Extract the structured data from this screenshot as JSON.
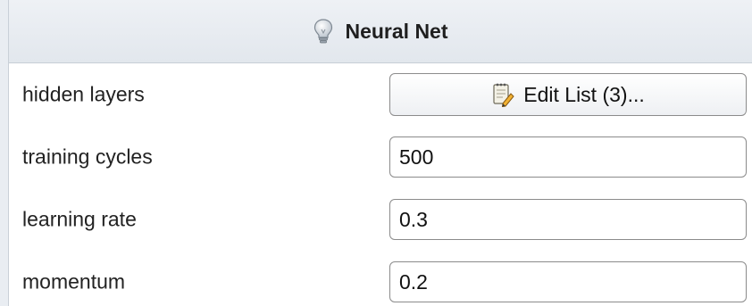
{
  "header": {
    "title": "Neural Net",
    "icon": "lightbulb-icon"
  },
  "parameters": [
    {
      "label": "hidden layers",
      "type": "button",
      "button_label": "Edit List (3)...",
      "icon": "notepad-edit-icon"
    },
    {
      "label": "training cycles",
      "type": "input",
      "value": "500"
    },
    {
      "label": "learning rate",
      "type": "input",
      "value": "0.3"
    },
    {
      "label": "momentum",
      "type": "input",
      "value": "0.2"
    }
  ],
  "colors": {
    "header_bg": "#e6eaef",
    "border": "#8b8b8b",
    "text": "#222222"
  }
}
